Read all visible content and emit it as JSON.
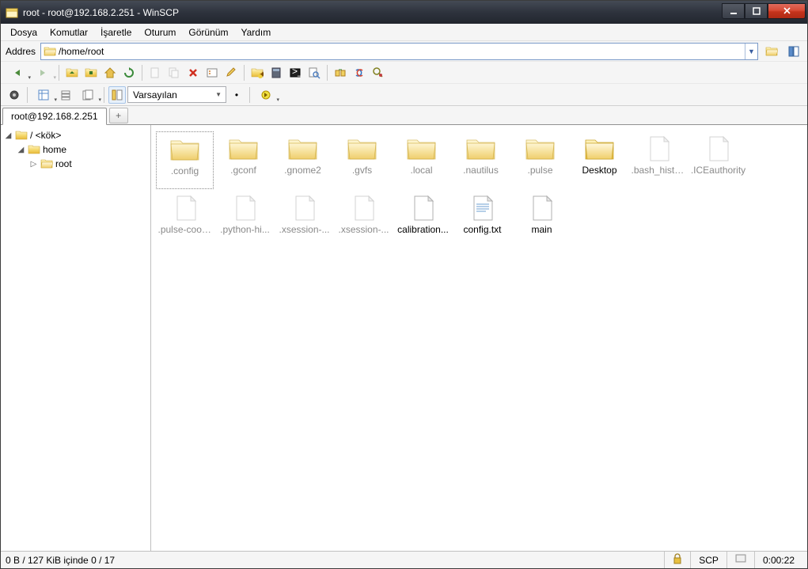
{
  "window": {
    "title": "root - root@192.168.2.251 - WinSCP"
  },
  "menu": {
    "items": [
      "Dosya",
      "Komutlar",
      "İşaretle",
      "Oturum",
      "Görünüm",
      "Yardım"
    ]
  },
  "address": {
    "label": "Addres",
    "path": "/home/root"
  },
  "toolbar2": {
    "preset": "Varsayılan"
  },
  "tabs": {
    "active": "root@192.168.2.251",
    "add": "+"
  },
  "tree": {
    "root": "/ <kök>",
    "home": "home",
    "leaf": "root"
  },
  "files": [
    {
      "name": ".config",
      "type": "folder",
      "hidden": true,
      "selected": true
    },
    {
      "name": ".gconf",
      "type": "folder",
      "hidden": true
    },
    {
      "name": ".gnome2",
      "type": "folder",
      "hidden": true
    },
    {
      "name": ".gvfs",
      "type": "folder",
      "hidden": true
    },
    {
      "name": ".local",
      "type": "folder",
      "hidden": true
    },
    {
      "name": ".nautilus",
      "type": "folder",
      "hidden": true
    },
    {
      "name": ".pulse",
      "type": "folder",
      "hidden": true
    },
    {
      "name": "Desktop",
      "type": "folder",
      "hidden": false
    },
    {
      "name": ".bash_history",
      "type": "file",
      "hidden": true
    },
    {
      "name": ".ICEauthority",
      "type": "file",
      "hidden": true
    },
    {
      "name": ".pulse-cookie",
      "type": "file",
      "hidden": true
    },
    {
      "name": ".python-hi...",
      "type": "file",
      "hidden": true
    },
    {
      "name": ".xsession-...",
      "type": "file",
      "hidden": true
    },
    {
      "name": ".xsession-...",
      "type": "file",
      "hidden": true
    },
    {
      "name": "calibration...",
      "type": "file",
      "hidden": false
    },
    {
      "name": "config.txt",
      "type": "textfile",
      "hidden": false
    },
    {
      "name": "main",
      "type": "file",
      "hidden": false
    }
  ],
  "status": {
    "left": "0 B / 127 KiB içinde 0 / 17",
    "protocol": "SCP",
    "time": "0:00:22"
  }
}
